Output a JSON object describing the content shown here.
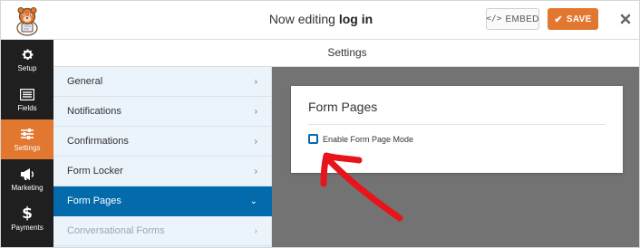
{
  "header": {
    "title_prefix": "Now editing",
    "title_form": "log in",
    "embed_label": "EMBED",
    "save_label": "SAVE"
  },
  "sidebar": {
    "items": [
      {
        "label": "Setup",
        "icon": "gear-icon"
      },
      {
        "label": "Fields",
        "icon": "fields-icon"
      },
      {
        "label": "Settings",
        "icon": "sliders-icon",
        "active": true
      },
      {
        "label": "Marketing",
        "icon": "megaphone-icon"
      },
      {
        "label": "Payments",
        "icon": "dollar-icon"
      }
    ]
  },
  "settings_bar": {
    "title": "Settings"
  },
  "menu": {
    "items": [
      {
        "label": "General"
      },
      {
        "label": "Notifications"
      },
      {
        "label": "Confirmations"
      },
      {
        "label": "Form Locker"
      },
      {
        "label": "Form Pages",
        "active": true
      },
      {
        "label": "Conversational Forms",
        "disabled": true
      }
    ]
  },
  "panel": {
    "title": "Form Pages",
    "checkbox_label": "Enable Form Page Mode",
    "checkbox_checked": false
  },
  "colors": {
    "accent": "#e27730",
    "active_blue": "#036aab",
    "sidebar_bg": "#1f1f1f",
    "menu_bg": "#ebf3fb",
    "content_bg": "#737373",
    "annotation_arrow": "#e8141c"
  }
}
